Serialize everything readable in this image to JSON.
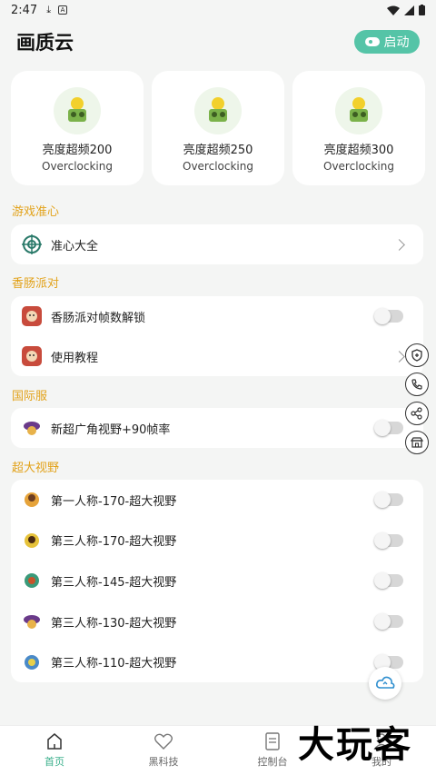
{
  "status_bar": {
    "time": "2:47"
  },
  "header": {
    "title": "画质云",
    "launch_label": "启动"
  },
  "cards": [
    {
      "title": "亮度超频200",
      "subtitle": "Overclocking"
    },
    {
      "title": "亮度超频250",
      "subtitle": "Overclocking"
    },
    {
      "title": "亮度超频300",
      "subtitle": "Overclocking"
    }
  ],
  "sections": {
    "crosshair": {
      "title": "游戏准心",
      "rows": [
        {
          "label": "准心大全"
        }
      ]
    },
    "sausage": {
      "title": "香肠派对",
      "rows": [
        {
          "label": "香肠派对帧数解锁"
        },
        {
          "label": "使用教程"
        }
      ]
    },
    "intl": {
      "title": "国际服",
      "rows": [
        {
          "label": "新超广角视野+90帧率"
        }
      ]
    },
    "fov": {
      "title": "超大视野",
      "rows": [
        {
          "label": "第一人称-170-超大视野"
        },
        {
          "label": "第三人称-170-超大视野"
        },
        {
          "label": "第三人称-145-超大视野"
        },
        {
          "label": "第三人称-130-超大视野"
        },
        {
          "label": "第三人称-110-超大视野"
        }
      ]
    }
  },
  "bottom_nav": [
    {
      "label": "首页",
      "icon": "home-icon",
      "active": true
    },
    {
      "label": "黑科技",
      "icon": "heart-icon"
    },
    {
      "label": "控制台",
      "icon": "console-icon"
    },
    {
      "label": "我的",
      "icon": "profile-icon"
    }
  ],
  "watermark": "大玩客",
  "colors": {
    "accent": "#55c4a7",
    "section_title": "#e2a21a",
    "nav_active": "#3bb08c"
  }
}
